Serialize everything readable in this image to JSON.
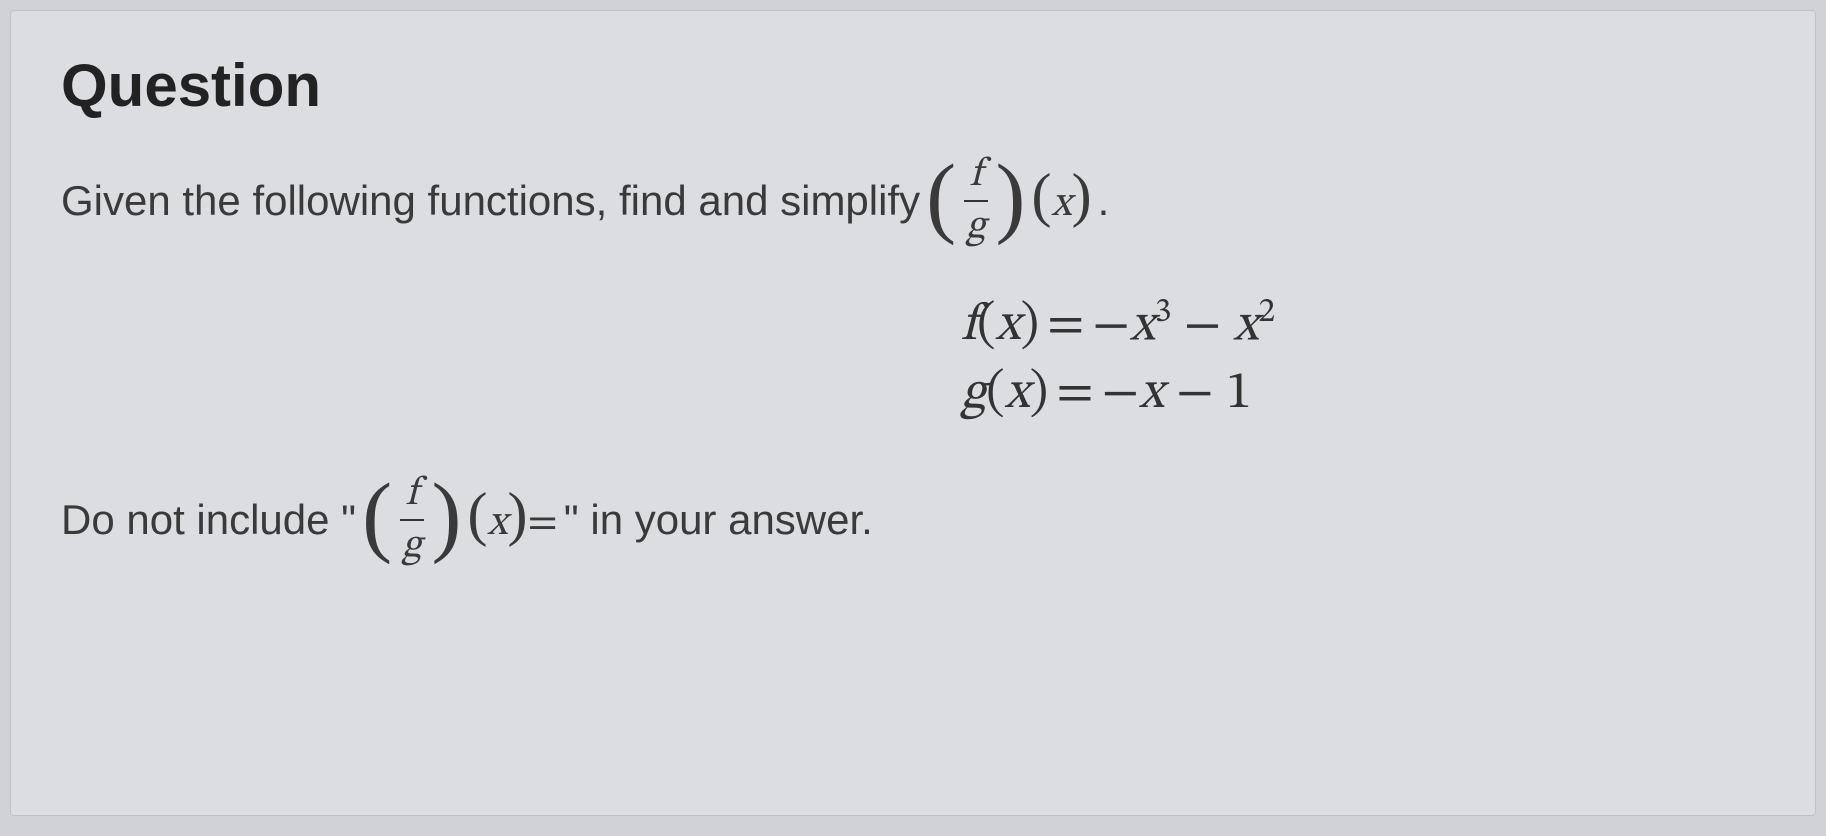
{
  "heading": "Question",
  "prompt_prefix": "Given the following functions, find and simplify ",
  "frac_num": "f",
  "frac_den": "g",
  "var": "x",
  "period": ".",
  "functions": {
    "f_lhs_name": "f",
    "f_lhs_open": "(",
    "f_lhs_var": "x",
    "f_lhs_close": ")",
    "eq": " = ",
    "f_rhs_m1": "−",
    "f_rhs_t1_base": "x",
    "f_rhs_t1_exp": "3",
    "f_rhs_m2": " − ",
    "f_rhs_t2_base": "x",
    "f_rhs_t2_exp": "2",
    "g_lhs_name": "g",
    "g_lhs_open": "(",
    "g_lhs_var": "x",
    "g_lhs_close": ")",
    "g_rhs_m1": "−",
    "g_rhs_t1": "x",
    "g_rhs_m2": " − ",
    "g_rhs_t2": "1"
  },
  "noinclude_prefix": "Do not include \"",
  "noinclude_eq": "=",
  "noinclude_suffix": "\" in your answer."
}
